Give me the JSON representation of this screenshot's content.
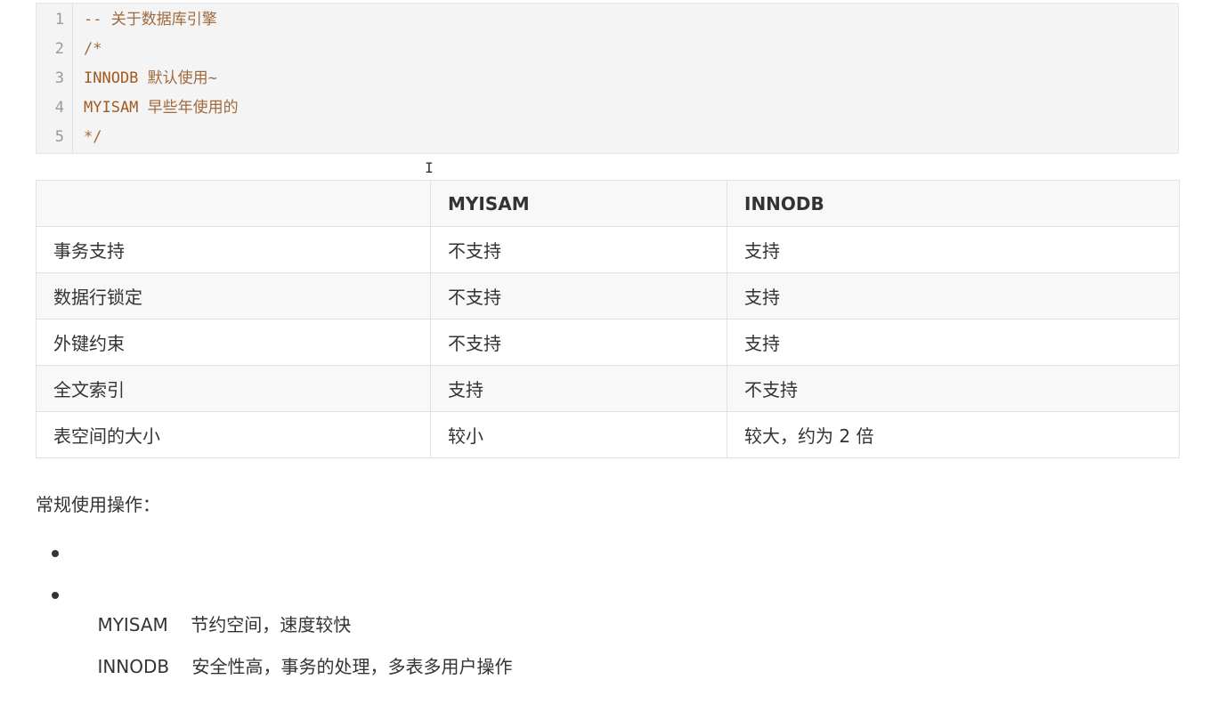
{
  "code_block": {
    "lines": [
      {
        "num": "1",
        "keyword": "",
        "text": "-- 关于数据库引擎"
      },
      {
        "num": "2",
        "keyword": "",
        "text": "/*"
      },
      {
        "num": "3",
        "keyword": "INNODB",
        "text": " 默认使用~"
      },
      {
        "num": "4",
        "keyword": "MYISAM",
        "text": " 早些年使用的"
      },
      {
        "num": "5",
        "keyword": "",
        "text": "*/"
      }
    ]
  },
  "table": {
    "headers": [
      "",
      "MYISAM",
      "INNODB"
    ],
    "rows": [
      [
        "事务支持",
        "不支持",
        "支持"
      ],
      [
        "数据行锁定",
        "不支持",
        "支持"
      ],
      [
        "外键约束",
        "不支持",
        "支持"
      ],
      [
        "全文索引",
        "支持",
        "不支持"
      ],
      [
        "表空间的大小",
        "较小",
        "较大，约为 2 倍"
      ]
    ]
  },
  "usage": {
    "intro": "常规使用操作：",
    "items": [
      "MYISAM    节约空间，速度较快",
      "INNODB    安全性高，事务的处理，多表多用户操作"
    ]
  }
}
